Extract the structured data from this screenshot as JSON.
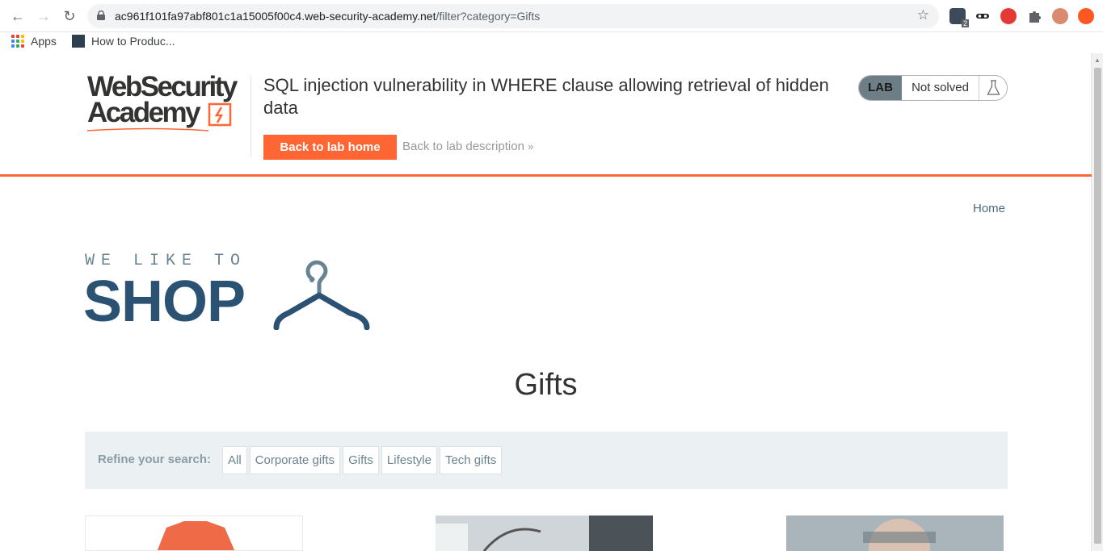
{
  "browser": {
    "url_host": "ac961f101fa97abf801c1a15005f00c4.web-security-academy.net",
    "url_path": "/filter?category=Gifts",
    "ext_badge": "2",
    "bookmarks": [
      {
        "label": "Apps"
      },
      {
        "label": "How to Produc..."
      }
    ]
  },
  "lab": {
    "logo_line1": "WebSecurity",
    "logo_line2": "Academy",
    "title": "SQL injection vulnerability in WHERE clause allowing retrieval of hidden data",
    "back_home": "Back to lab home",
    "back_description": "Back to lab description",
    "back_description_icon": "double-chevron-right-icon",
    "badge": "LAB",
    "status": "Not solved",
    "status_icon": "flask-icon"
  },
  "shop": {
    "home_link": "Home",
    "logo_tagline": "WE LIKE TO",
    "logo_word": "SHOP",
    "logo_icon": "hanger-icon",
    "category_title": "Gifts",
    "refine_label": "Refine your search:",
    "filters": [
      "All",
      "Corporate gifts",
      "Gifts",
      "Lifestyle",
      "Tech gifts"
    ]
  },
  "colors": {
    "accent": "#ff6633",
    "shop_blue": "#2b5273",
    "link": "#4a6c80",
    "filter_bg": "#ebf0f2"
  }
}
